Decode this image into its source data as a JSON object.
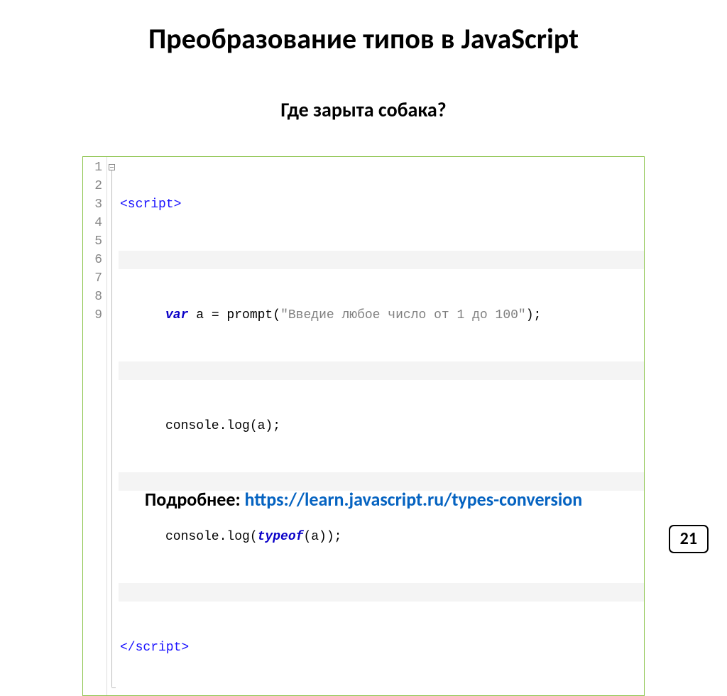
{
  "title": "Преобразование типов в JavaScript",
  "subtitle": "Где зарыта собака?",
  "code": {
    "lines": [
      "1",
      "2",
      "3",
      "4",
      "5",
      "6",
      "7",
      "8",
      "9"
    ],
    "l1_tag_open": "<script>",
    "l3_kw": "var",
    "l3_rest1": " a ",
    "l3_eq": "=",
    "l3_rest2": " prompt",
    "l3_paren_open": "(",
    "l3_str": "\"Введие любое число от 1 до 100\"",
    "l3_paren_close": ")",
    "l3_semi": ";",
    "l5": "console.log(a);",
    "l7_a": "console.log(",
    "l7_kw": "typeof",
    "l7_b": "(a));",
    "l9_tag_close": "</script>"
  },
  "footer": {
    "label": "Подробнее: ",
    "url": "https://learn.javascript.ru/types-conversion"
  },
  "page_number": "21"
}
